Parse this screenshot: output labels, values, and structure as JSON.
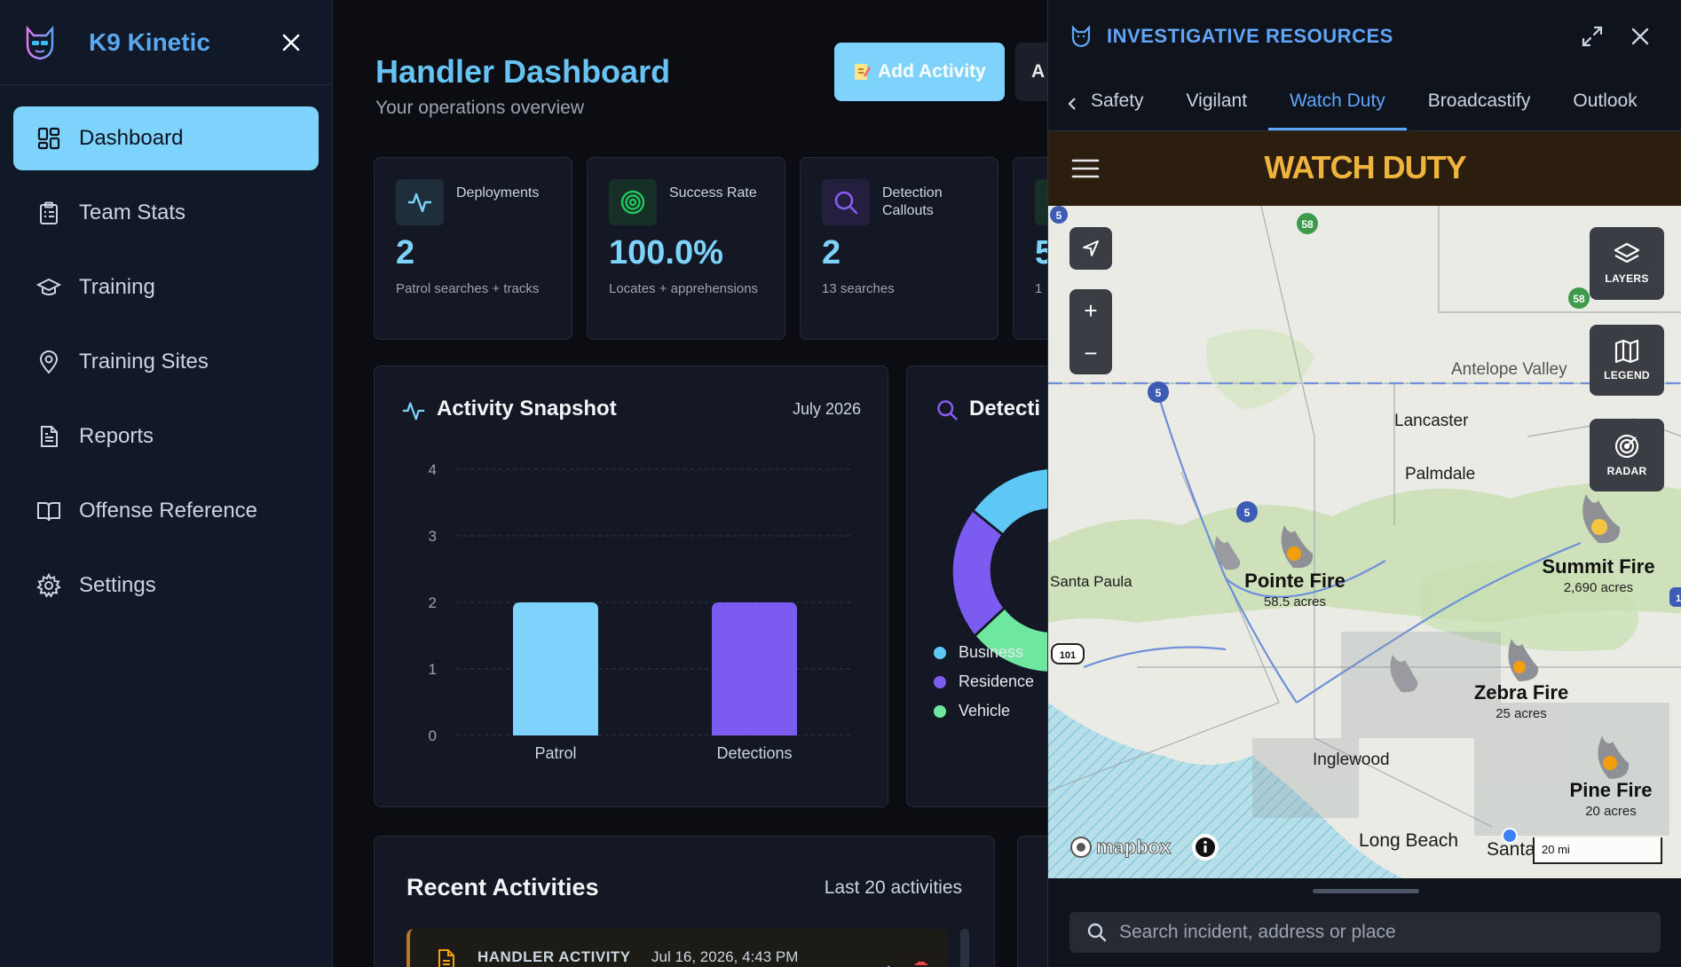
{
  "app": {
    "name": "K9 Kinetic"
  },
  "sidebar": {
    "items": [
      {
        "label": "Dashboard",
        "icon": "dashboard-icon",
        "active": true
      },
      {
        "label": "Team Stats",
        "icon": "clipboard-icon"
      },
      {
        "label": "Training",
        "icon": "graduation-cap-icon"
      },
      {
        "label": "Training Sites",
        "icon": "map-pin-icon"
      },
      {
        "label": "Reports",
        "icon": "file-text-icon"
      },
      {
        "label": "Offense Reference",
        "icon": "book-icon"
      },
      {
        "label": "Settings",
        "icon": "gear-icon"
      }
    ]
  },
  "header": {
    "title": "Handler Dashboard",
    "subtitle": "Your operations overview",
    "add_activity": "Add Activity",
    "second_button": "A"
  },
  "stats": [
    {
      "label": "Deployments",
      "value": "2",
      "sub": "Patrol searches + tracks",
      "icon": "activity-icon",
      "color": "#7dd3fc"
    },
    {
      "label": "Success Rate",
      "value": "100.0%",
      "sub": "Locates + apprehensions",
      "icon": "target-icon",
      "color": "#22c55e"
    },
    {
      "label": "Detection Callouts",
      "value": "2",
      "sub": "13 searches",
      "icon": "search-icon",
      "color": "#8b5cf6"
    },
    {
      "label": "",
      "value": "5",
      "sub": "1",
      "icon": "partial-icon",
      "color": "#22c55e"
    }
  ],
  "snapshot": {
    "title": "Activity Snapshot",
    "date": "July 2026"
  },
  "chart_data": {
    "type": "bar",
    "categories": [
      "Patrol",
      "Detections"
    ],
    "values": [
      2,
      2
    ],
    "colors": [
      "#7dd3fc",
      "#7c5cf0"
    ],
    "ylim": [
      0,
      4
    ],
    "yticks": [
      "0",
      "1",
      "2",
      "3",
      "4"
    ],
    "grid": true
  },
  "detection": {
    "title": "Detecti",
    "legend": [
      {
        "label": "Business",
        "color": "#5ec8f5"
      },
      {
        "label": "Residence",
        "color": "#7c5cf0"
      },
      {
        "label": "Vehicle",
        "color": "#6ee7a0"
      }
    ]
  },
  "recent": {
    "title": "Recent Activities",
    "subtitle": "Last 20 activities",
    "first": {
      "type": "HANDLER ACTIVITY",
      "date": "Jul 16, 2026, 4:43 PM"
    }
  },
  "panel": {
    "title": "INVESTIGATIVE RESOURCES",
    "tabs": [
      "Safety",
      "Vigilant",
      "Watch Duty",
      "Broadcastify",
      "Outlook"
    ],
    "active_tab": "Watch Duty",
    "watchduty": {
      "brand": "WATCH DUTY",
      "buttons": [
        "LAYERS",
        "LEGEND",
        "RADAR"
      ],
      "places": [
        "Antelope Valley",
        "Lancaster",
        "Palmdale",
        "Santa Paula",
        "Inglewood",
        "Long Beach",
        "Santa"
      ],
      "fires": [
        {
          "name": "Pointe Fire",
          "acres": "58.5 acres"
        },
        {
          "name": "Summit Fire",
          "acres": "2,690 acres"
        },
        {
          "name": "Zebra Fire",
          "acres": "25 acres"
        },
        {
          "name": "Pine Fire",
          "acres": "20 acres"
        }
      ],
      "highways": [
        "5",
        "58",
        "58",
        "5",
        "5",
        "101",
        "1"
      ],
      "scale": "20 mi",
      "attribution": "mapbox",
      "search_placeholder": "Search incident, address or place"
    }
  }
}
